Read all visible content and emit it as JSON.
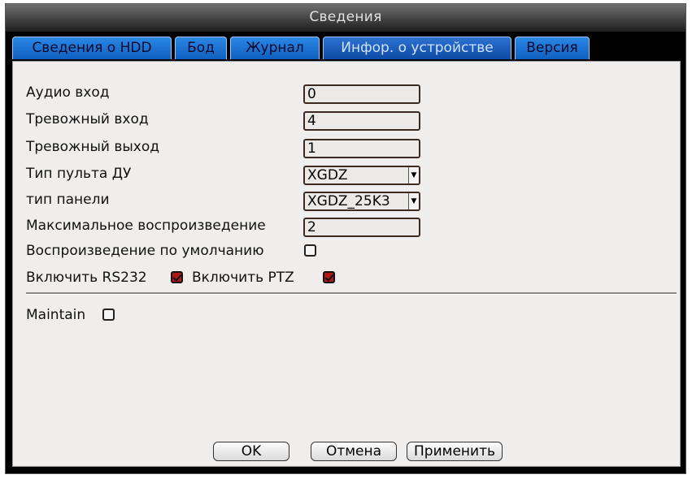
{
  "window": {
    "title": "Сведения"
  },
  "tabs": [
    {
      "label": "Сведения о HDD",
      "active": false
    },
    {
      "label": "Бод",
      "active": false
    },
    {
      "label": "Журнал",
      "active": false
    },
    {
      "label": "Инфор. о устройстве",
      "active": true
    },
    {
      "label": "Версия",
      "active": false
    }
  ],
  "fields": {
    "audio_in": {
      "label": "Аудио вход",
      "value": "0"
    },
    "alarm_in": {
      "label": "Тревожный вход",
      "value": "4"
    },
    "alarm_out": {
      "label": "Тревожный выход",
      "value": "1"
    },
    "remote_type": {
      "label": "Тип пульта ДУ",
      "value": "XGDZ"
    },
    "panel_type": {
      "label": "тип панели",
      "value": "XGDZ_25K3"
    },
    "max_playback": {
      "label": "Максимальное воспроизведение",
      "value": "2"
    },
    "default_playback": {
      "label": "Воспроизведение по умолчанию",
      "checked": false
    },
    "rs232": {
      "label": "Включить RS232",
      "checked": true
    },
    "ptz": {
      "label": "Включить PTZ",
      "checked": true
    },
    "maintain": {
      "label": "Maintain",
      "checked": false
    }
  },
  "buttons": {
    "ok": "OK",
    "cancel": "Отмена",
    "apply": "Применить"
  },
  "colors": {
    "tab_blue": "#1f78dc",
    "check_red": "#b01818",
    "panel_bg": "#efeeed"
  }
}
